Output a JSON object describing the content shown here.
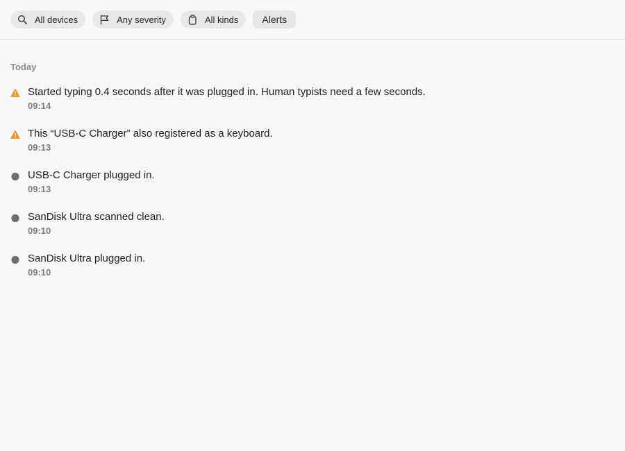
{
  "filters": {
    "devices_label": "All devices",
    "severity_label": "Any severity",
    "kinds_label": "All kinds",
    "alerts_label": "Alerts"
  },
  "icons": {
    "devices": "search-icon",
    "severity": "flag-icon",
    "kinds": "clipboard-icon",
    "warning": "warning-icon",
    "info": "dot-icon"
  },
  "colors": {
    "warning": "#f0922d",
    "info": "#6e6e6e"
  },
  "section": {
    "label": "Today"
  },
  "events": [
    {
      "text": "Started typing 0.4 seconds after it was plugged in. Human typists need a few seconds.",
      "time": "09:14",
      "severity": "warning"
    },
    {
      "text": "This “USB-C Charger” also registered as a keyboard.",
      "time": "09:13",
      "severity": "warning"
    },
    {
      "text": "USB-C Charger plugged in.",
      "time": "09:13",
      "severity": "info"
    },
    {
      "text": "SanDisk Ultra scanned clean.",
      "time": "09:10",
      "severity": "info"
    },
    {
      "text": "SanDisk Ultra plugged in.",
      "time": "09:10",
      "severity": "info"
    }
  ]
}
